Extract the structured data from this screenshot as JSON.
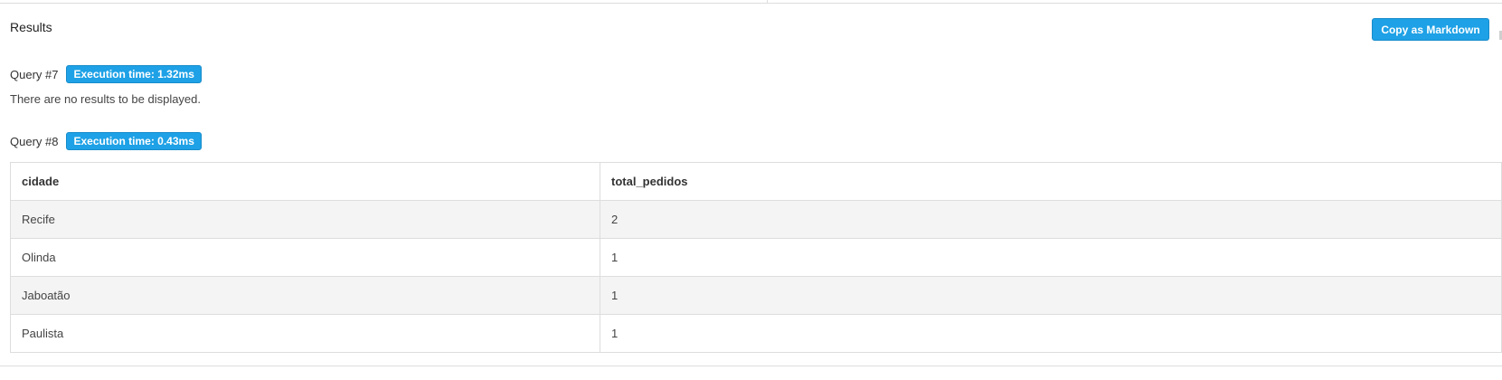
{
  "panel": {
    "title": "Results",
    "copy_button_label": "Copy as Markdown",
    "accent_color": "#1ea1e6"
  },
  "queries": [
    {
      "label": "Query #7",
      "execution_badge": "Execution time: 1.32ms",
      "message": "There are no results to be displayed."
    },
    {
      "label": "Query #8",
      "execution_badge": "Execution time: 0.43ms",
      "table": {
        "columns": [
          "cidade",
          "total_pedidos"
        ],
        "rows": [
          [
            "Recife",
            "2"
          ],
          [
            "Olinda",
            "1"
          ],
          [
            "Jaboatão",
            "1"
          ],
          [
            "Paulista",
            "1"
          ]
        ]
      }
    }
  ]
}
